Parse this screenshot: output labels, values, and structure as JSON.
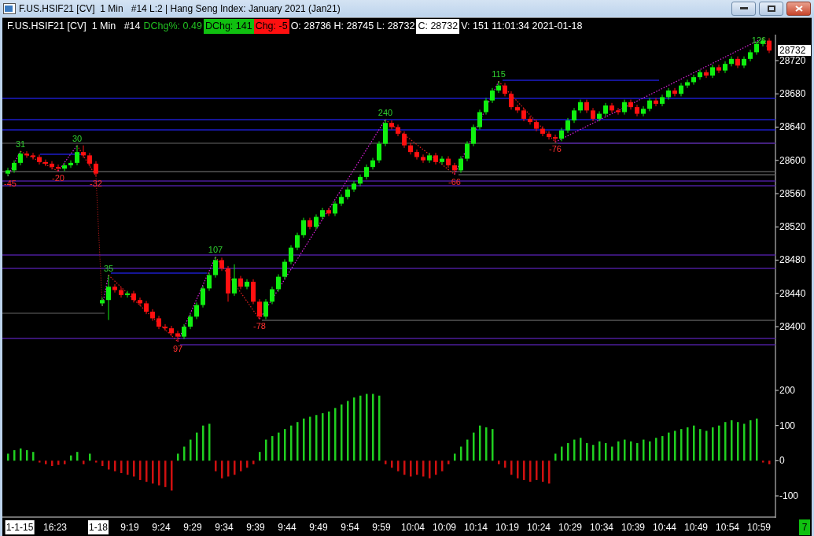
{
  "window": {
    "title": "F.US.HSIF21 [CV]  1 Min   #14 L:2 | Hang Seng Index: January 2021 (Jan21)"
  },
  "info_bar": [
    {
      "text": "F.US.HSIF21 [CV]  1 Min   #14",
      "kind": "plain"
    },
    {
      "text": "DChg%: 0.49",
      "kind": "green_text"
    },
    {
      "text": "DChg: 141",
      "kind": "green_fill"
    },
    {
      "text": "Chg: -5",
      "kind": "red_fill"
    },
    {
      "text": "O: 28736 H: 28745 L: 28732",
      "kind": "plain"
    },
    {
      "text": "C: 28732",
      "kind": "white_fill"
    },
    {
      "text": "V: 151 11:01:34 2021-01-18",
      "kind": "plain"
    }
  ],
  "swing_labels": [
    {
      "text": "-45",
      "kind": "low"
    },
    {
      "text": "31",
      "kind": "high"
    },
    {
      "text": "-20",
      "kind": "low"
    },
    {
      "text": "30",
      "kind": "high"
    },
    {
      "text": "-32",
      "kind": "low"
    },
    {
      "text": "35",
      "kind": "high"
    },
    {
      "text": "97",
      "kind": "low"
    },
    {
      "text": "107",
      "kind": "high"
    },
    {
      "text": "-78",
      "kind": "low"
    },
    {
      "text": "240",
      "kind": "high"
    },
    {
      "text": "-66",
      "kind": "low"
    },
    {
      "text": "115",
      "kind": "high"
    },
    {
      "text": "-76",
      "kind": "low"
    },
    {
      "text": "126",
      "kind": "high"
    }
  ],
  "price_chart": {
    "current_price": "28732",
    "chart_data": {
      "type": "candlestick",
      "ylim": [
        28400,
        28751.2
      ],
      "categories": [
        null,
        null,
        null,
        null,
        null,
        null,
        null,
        null,
        null,
        null,
        null,
        null,
        null,
        null,
        null,
        null,
        null,
        null,
        null,
        null,
        null,
        null,
        null,
        null,
        null,
        null,
        null,
        null,
        null,
        null,
        null,
        null,
        null,
        null,
        null,
        null,
        null,
        null,
        null,
        null,
        null,
        null,
        null,
        null,
        null,
        null,
        null,
        null,
        null,
        null,
        null,
        null,
        null,
        null,
        null,
        null,
        null,
        null,
        null,
        null,
        null,
        null,
        null,
        null,
        null,
        null,
        null,
        null,
        null,
        null,
        null,
        null,
        null,
        null,
        null,
        null,
        null,
        null,
        null,
        null,
        null,
        null,
        null,
        null,
        null,
        null,
        null,
        null,
        null,
        null,
        null,
        null,
        null,
        null,
        null,
        null,
        null,
        null,
        null,
        null,
        null,
        null,
        null,
        null,
        null,
        null,
        null,
        null,
        null,
        null,
        null,
        null,
        null,
        null,
        null,
        null,
        null,
        null,
        null,
        null,
        null,
        null
      ],
      "yticks": [
        {
          "value": 28720,
          "label": "28720"
        },
        {
          "value": 28680,
          "label": "28680"
        },
        {
          "value": 28640,
          "label": "28640"
        },
        {
          "value": 28600,
          "label": "28600"
        },
        {
          "value": 28560,
          "label": "28560"
        },
        {
          "value": 28520,
          "label": "28520"
        },
        {
          "value": 28480,
          "label": "28480"
        },
        {
          "value": 28440,
          "label": "28440"
        },
        {
          "value": 28400,
          "label": "28400"
        }
      ],
      "ohlc": [
        [
          28584,
          28591,
          28581,
          28588
        ],
        [
          28588,
          28600,
          28585,
          28597
        ],
        [
          28597,
          28611,
          28594,
          28608
        ],
        [
          28608,
          28611,
          28603,
          28606
        ],
        [
          28606,
          28609,
          28601,
          28604
        ],
        [
          28604,
          28607,
          28595,
          28598
        ],
        [
          28598,
          28601,
          28593,
          28596
        ],
        [
          28596,
          28599,
          28589,
          28592
        ],
        [
          28592,
          28595,
          28587,
          28590
        ],
        [
          28590,
          28597,
          28587,
          28594
        ],
        [
          28594,
          28600,
          28591,
          28597
        ],
        [
          28597,
          28618,
          28594,
          28610
        ],
        [
          28610,
          28618,
          28603,
          28606
        ],
        [
          28606,
          28609,
          28593,
          28596
        ],
        [
          28596,
          28599,
          28581,
          28584
        ],
        [
          28428,
          28435,
          28425,
          28432
        ],
        [
          28432,
          28462,
          28408,
          28448
        ],
        [
          28448,
          28451,
          28441,
          28444
        ],
        [
          28444,
          28447,
          28435,
          28438
        ],
        [
          28438,
          28443,
          28435,
          28440
        ],
        [
          28440,
          28443,
          28429,
          28432
        ],
        [
          28432,
          28435,
          28425,
          28428
        ],
        [
          28428,
          28431,
          28415,
          28418
        ],
        [
          28418,
          28421,
          28407,
          28410
        ],
        [
          28410,
          28413,
          28397,
          28400
        ],
        [
          28400,
          28403,
          28395,
          28398
        ],
        [
          28398,
          28401,
          28389,
          28392
        ],
        [
          28392,
          28395,
          28382,
          28388
        ],
        [
          28388,
          28403,
          28385,
          28400
        ],
        [
          28400,
          28415,
          28397,
          28412
        ],
        [
          28412,
          28429,
          28409,
          28426
        ],
        [
          28426,
          28449,
          28423,
          28446
        ],
        [
          28446,
          28465,
          28443,
          28462
        ],
        [
          28462,
          28484,
          28459,
          28480
        ],
        [
          28480,
          28483,
          28467,
          28470
        ],
        [
          28470,
          28473,
          28430,
          28440
        ],
        [
          28440,
          28475,
          28437,
          28458
        ],
        [
          28458,
          28461,
          28445,
          28448
        ],
        [
          28448,
          28457,
          28445,
          28454
        ],
        [
          28454,
          28457,
          28427,
          28430
        ],
        [
          28430,
          28433,
          28409,
          28412
        ],
        [
          28412,
          28433,
          28409,
          28430
        ],
        [
          28430,
          28448,
          28427,
          28445
        ],
        [
          28445,
          28463,
          28442,
          28460
        ],
        [
          28460,
          28481,
          28457,
          28478
        ],
        [
          28478,
          28498,
          28475,
          28495
        ],
        [
          28495,
          28513,
          28492,
          28510
        ],
        [
          28510,
          28531,
          28507,
          28528
        ],
        [
          28528,
          28531,
          28517,
          28520
        ],
        [
          28520,
          28535,
          28517,
          28532
        ],
        [
          28532,
          28543,
          28529,
          28540
        ],
        [
          28540,
          28543,
          28533,
          28536
        ],
        [
          28536,
          28551,
          28533,
          28548
        ],
        [
          28548,
          28559,
          28545,
          28556
        ],
        [
          28556,
          28568,
          28553,
          28565
        ],
        [
          28565,
          28575,
          28562,
          28572
        ],
        [
          28572,
          28583,
          28569,
          28580
        ],
        [
          28580,
          28595,
          28577,
          28592
        ],
        [
          28592,
          28603,
          28589,
          28600
        ],
        [
          28600,
          28623,
          28597,
          28620
        ],
        [
          28620,
          28649,
          28617,
          28645
        ],
        [
          28645,
          28648,
          28637,
          28640
        ],
        [
          28640,
          28643,
          28629,
          28632
        ],
        [
          28632,
          28635,
          28615,
          28618
        ],
        [
          28618,
          28621,
          28607,
          28610
        ],
        [
          28610,
          28613,
          28601,
          28604
        ],
        [
          28604,
          28607,
          28597,
          28600
        ],
        [
          28600,
          28609,
          28597,
          28606
        ],
        [
          28606,
          28609,
          28595,
          28598
        ],
        [
          28598,
          28605,
          28595,
          28602
        ],
        [
          28602,
          28605,
          28591,
          28594
        ],
        [
          28594,
          28597,
          28583,
          28588
        ],
        [
          28588,
          28605,
          28585,
          28602
        ],
        [
          28602,
          28623,
          28599,
          28620
        ],
        [
          28620,
          28643,
          28617,
          28640
        ],
        [
          28640,
          28661,
          28637,
          28658
        ],
        [
          28658,
          28675,
          28655,
          28672
        ],
        [
          28672,
          28687,
          28669,
          28684
        ],
        [
          28684,
          28695,
          28681,
          28690
        ],
        [
          28690,
          28693,
          28677,
          28680
        ],
        [
          28680,
          28683,
          28661,
          28664
        ],
        [
          28664,
          28667,
          28657,
          28660
        ],
        [
          28660,
          28663,
          28647,
          28650
        ],
        [
          28650,
          28653,
          28643,
          28646
        ],
        [
          28646,
          28649,
          28635,
          28638
        ],
        [
          28638,
          28641,
          28629,
          28632
        ],
        [
          28632,
          28635,
          28625,
          28628
        ],
        [
          28628,
          28631,
          28622,
          28626
        ],
        [
          28626,
          28639,
          28623,
          28636
        ],
        [
          28636,
          28651,
          28633,
          28648
        ],
        [
          28648,
          28663,
          28645,
          28660
        ],
        [
          28660,
          28673,
          28657,
          28670
        ],
        [
          28670,
          28673,
          28657,
          28660
        ],
        [
          28660,
          28663,
          28647,
          28650
        ],
        [
          28650,
          28659,
          28647,
          28656
        ],
        [
          28656,
          28669,
          28653,
          28666
        ],
        [
          28666,
          28669,
          28657,
          28660
        ],
        [
          28660,
          28663,
          28655,
          28658
        ],
        [
          28658,
          28673,
          28655,
          28670
        ],
        [
          28670,
          28673,
          28661,
          28664
        ],
        [
          28664,
          28667,
          28653,
          28656
        ],
        [
          28656,
          28665,
          28653,
          28662
        ],
        [
          28662,
          28675,
          28659,
          28672
        ],
        [
          28672,
          28675,
          28665,
          28668
        ],
        [
          28668,
          28679,
          28665,
          28676
        ],
        [
          28676,
          28687,
          28673,
          28684
        ],
        [
          28684,
          28687,
          28677,
          28680
        ],
        [
          28680,
          28693,
          28677,
          28690
        ],
        [
          28690,
          28697,
          28687,
          28694
        ],
        [
          28694,
          28703,
          28691,
          28700
        ],
        [
          28700,
          28709,
          28697,
          28706
        ],
        [
          28706,
          28709,
          28699,
          28702
        ],
        [
          28702,
          28715,
          28699,
          28712
        ],
        [
          28712,
          28715,
          28705,
          28708
        ],
        [
          28708,
          28719,
          28705,
          28716
        ],
        [
          28716,
          28725,
          28713,
          28722
        ],
        [
          28722,
          28725,
          28711,
          28714
        ],
        [
          28714,
          28725,
          28711,
          28722
        ],
        [
          28722,
          28733,
          28719,
          28730
        ],
        [
          28730,
          28743,
          28727,
          28740
        ],
        [
          28740,
          28747,
          28737,
          28744
        ],
        [
          28744,
          28747,
          28729,
          28732
        ]
      ]
    }
  },
  "histogram": {
    "chart_data": {
      "type": "bar",
      "ylim": [
        -160.4,
        200
      ],
      "categories": [
        null,
        null,
        null,
        null,
        null,
        null,
        null,
        null,
        null,
        null,
        null,
        null,
        null,
        null,
        null,
        null,
        null,
        null,
        null,
        null,
        null,
        null,
        null,
        null,
        null,
        null,
        null,
        null,
        null,
        null,
        null,
        null,
        null,
        null,
        null,
        null,
        null,
        null,
        null,
        null,
        null,
        null,
        null,
        null,
        null,
        null,
        null,
        null,
        null,
        null,
        null,
        null,
        null,
        null,
        null,
        null,
        null,
        null,
        null,
        null,
        null,
        null,
        null,
        null,
        null,
        null,
        null,
        null,
        null,
        null,
        null,
        null,
        null,
        null,
        null,
        null,
        null,
        null,
        null,
        null,
        null,
        null,
        null,
        null,
        null,
        null,
        null,
        null,
        null,
        null,
        null,
        null,
        null,
        null,
        null,
        null,
        null,
        null,
        null,
        null,
        null,
        null,
        null,
        null,
        null,
        null,
        null,
        null,
        null,
        null,
        null,
        null,
        null,
        null,
        null,
        null,
        null,
        null,
        null,
        null,
        null,
        null
      ],
      "yticks": [
        {
          "value": -100,
          "label": "-100"
        },
        {
          "value": 0,
          "label": "0"
        },
        {
          "value": 100,
          "label": "100"
        },
        {
          "value": 200,
          "label": "200"
        }
      ],
      "values": [
        20,
        30,
        35,
        30,
        25,
        -5,
        -10,
        -15,
        -12,
        -10,
        15,
        25,
        -10,
        20,
        -5,
        -15,
        -25,
        -30,
        -35,
        -40,
        -45,
        -55,
        -60,
        -65,
        -70,
        -75,
        -85,
        20,
        40,
        60,
        80,
        100,
        105,
        -30,
        -50,
        -45,
        -40,
        -30,
        -20,
        -10,
        25,
        60,
        70,
        80,
        90,
        100,
        110,
        120,
        125,
        130,
        135,
        140,
        150,
        160,
        170,
        180,
        185,
        190,
        190,
        185,
        -10,
        -20,
        -30,
        -40,
        -45,
        -40,
        -45,
        -50,
        -40,
        -30,
        -10,
        20,
        40,
        60,
        80,
        100,
        95,
        90,
        -10,
        -20,
        -40,
        -50,
        -55,
        -60,
        -55,
        -60,
        -65,
        20,
        40,
        50,
        60,
        65,
        50,
        45,
        55,
        50,
        40,
        55,
        60,
        55,
        50,
        60,
        55,
        65,
        70,
        80,
        85,
        90,
        95,
        100,
        90,
        85,
        95,
        100,
        110,
        115,
        110,
        105,
        115,
        120,
        -5,
        -10
      ]
    }
  },
  "time_axis": [
    {
      "text": "1-1-15",
      "highlighted": true
    },
    {
      "text": "16:23",
      "highlighted": false
    },
    {
      "text": "1-18",
      "highlighted": true
    },
    {
      "text": "9:19",
      "highlighted": false
    },
    {
      "text": "9:24",
      "highlighted": false
    },
    {
      "text": "9:29",
      "highlighted": false
    },
    {
      "text": "9:34",
      "highlighted": false
    },
    {
      "text": "9:39",
      "highlighted": false
    },
    {
      "text": "9:44",
      "highlighted": false
    },
    {
      "text": "9:49",
      "highlighted": false
    },
    {
      "text": "9:54",
      "highlighted": false
    },
    {
      "text": "9:59",
      "highlighted": false
    },
    {
      "text": "10:04",
      "highlighted": false
    },
    {
      "text": "10:09",
      "highlighted": false
    },
    {
      "text": "10:14",
      "highlighted": false
    },
    {
      "text": "10:19",
      "highlighted": false
    },
    {
      "text": "10:24",
      "highlighted": false
    },
    {
      "text": "10:29",
      "highlighted": false
    },
    {
      "text": "10:34",
      "highlighted": false
    },
    {
      "text": "10:39",
      "highlighted": false
    },
    {
      "text": "10:44",
      "highlighted": false
    },
    {
      "text": "10:49",
      "highlighted": false
    },
    {
      "text": "10:54",
      "highlighted": false
    },
    {
      "text": "10:59",
      "highlighted": false
    }
  ],
  "status_badge": "7"
}
